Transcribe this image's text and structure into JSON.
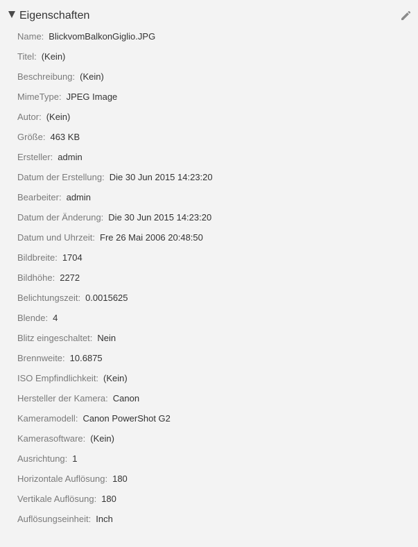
{
  "section": {
    "title": "Eigenschaften",
    "toggle_icon": "triangle-down-icon",
    "edit_icon": "pencil-icon"
  },
  "properties": [
    {
      "label": "Name:",
      "value": "BlickvomBalkonGiglio.JPG"
    },
    {
      "label": "Titel:",
      "value": "(Kein)"
    },
    {
      "label": "Beschreibung:",
      "value": "(Kein)"
    },
    {
      "label": "MimeType:",
      "value": "JPEG Image"
    },
    {
      "label": "Autor:",
      "value": "(Kein)"
    },
    {
      "label": "Größe:",
      "value": "463 KB"
    },
    {
      "label": "Ersteller:",
      "value": "admin"
    },
    {
      "label": "Datum der Erstellung:",
      "value": "Die 30 Jun 2015 14:23:20"
    },
    {
      "label": "Bearbeiter:",
      "value": "admin"
    },
    {
      "label": "Datum der Änderung:",
      "value": "Die 30 Jun 2015 14:23:20"
    },
    {
      "label": "Datum und Uhrzeit:",
      "value": "Fre 26 Mai 2006 20:48:50"
    },
    {
      "label": "Bildbreite:",
      "value": "1704"
    },
    {
      "label": "Bildhöhe:",
      "value": "2272"
    },
    {
      "label": "Belichtungszeit:",
      "value": "0.0015625"
    },
    {
      "label": "Blende:",
      "value": "4"
    },
    {
      "label": "Blitz eingeschaltet:",
      "value": "Nein"
    },
    {
      "label": "Brennweite:",
      "value": "10.6875"
    },
    {
      "label": "ISO Empfindlichkeit:",
      "value": "(Kein)"
    },
    {
      "label": "Hersteller der Kamera:",
      "value": "Canon"
    },
    {
      "label": "Kameramodell:",
      "value": "Canon PowerShot G2"
    },
    {
      "label": "Kamerasoftware:",
      "value": "(Kein)"
    },
    {
      "label": "Ausrichtung:",
      "value": "1"
    },
    {
      "label": "Horizontale Auflösung:",
      "value": "180"
    },
    {
      "label": "Vertikale Auflösung:",
      "value": "180"
    },
    {
      "label": "Auflösungseinheit:",
      "value": "Inch"
    }
  ]
}
